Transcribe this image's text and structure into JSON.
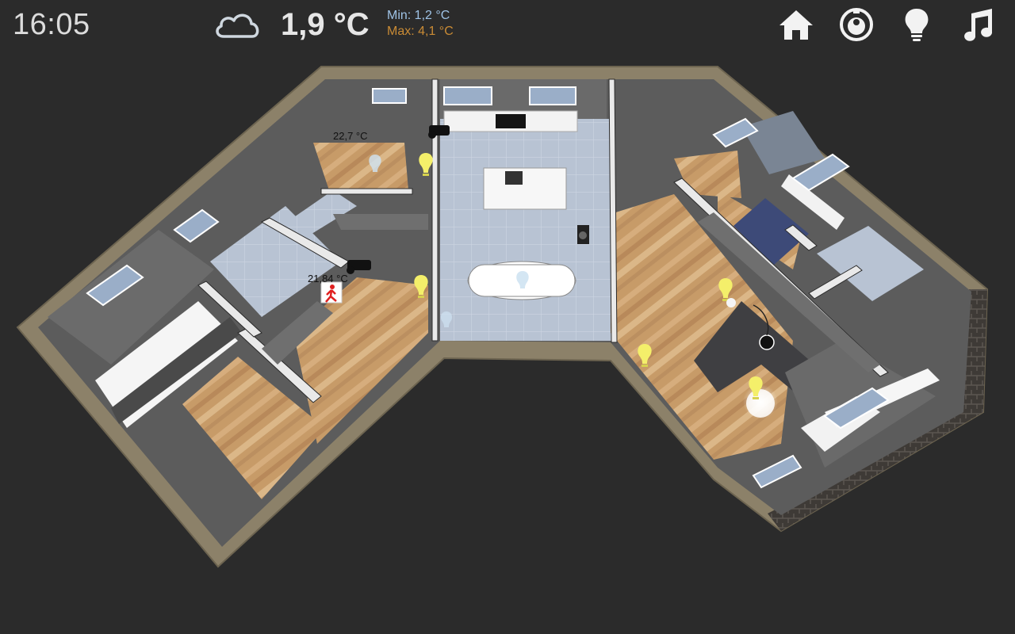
{
  "header": {
    "time": "16:05",
    "weather_icon": "cloud-icon",
    "temperature": "1,9 °C",
    "min": "Min: 1,2 °C",
    "max": "Max: 4,1 °C",
    "min_color": "#9fc3e6",
    "max_color": "#c98b35"
  },
  "nav": [
    {
      "name": "home",
      "icon": "home-icon"
    },
    {
      "name": "robot-vacuum",
      "icon": "robot-vacuum-icon"
    },
    {
      "name": "lights",
      "icon": "lightbulb-icon"
    },
    {
      "name": "music",
      "icon": "music-note-icon"
    }
  ],
  "floorplan": {
    "sensors": {
      "bedroom_temp": "22,7 °C",
      "bathroom_temp": "21,84 °C"
    },
    "colors": {
      "light_on": "#f4ef6a",
      "light_off": "#cfe3f2",
      "motion_alert": "#e02020"
    }
  }
}
